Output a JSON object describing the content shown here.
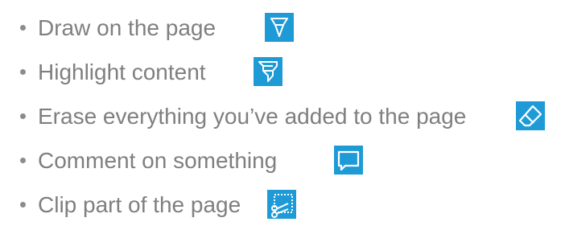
{
  "features": [
    {
      "label": "Draw on the page",
      "icon": "pen-icon"
    },
    {
      "label": "Highlight content",
      "icon": "highlighter-icon"
    },
    {
      "label": "Erase everything you’ve added to the page",
      "icon": "eraser-icon"
    },
    {
      "label": "Comment on something",
      "icon": "comment-icon"
    },
    {
      "label": "Clip part of the page",
      "icon": "clip-icon"
    }
  ],
  "colors": {
    "text": "#7f7f7f",
    "bullet": "#8c8c8c",
    "icon_background": "#1e9bd7",
    "icon_stroke": "#ffffff"
  }
}
